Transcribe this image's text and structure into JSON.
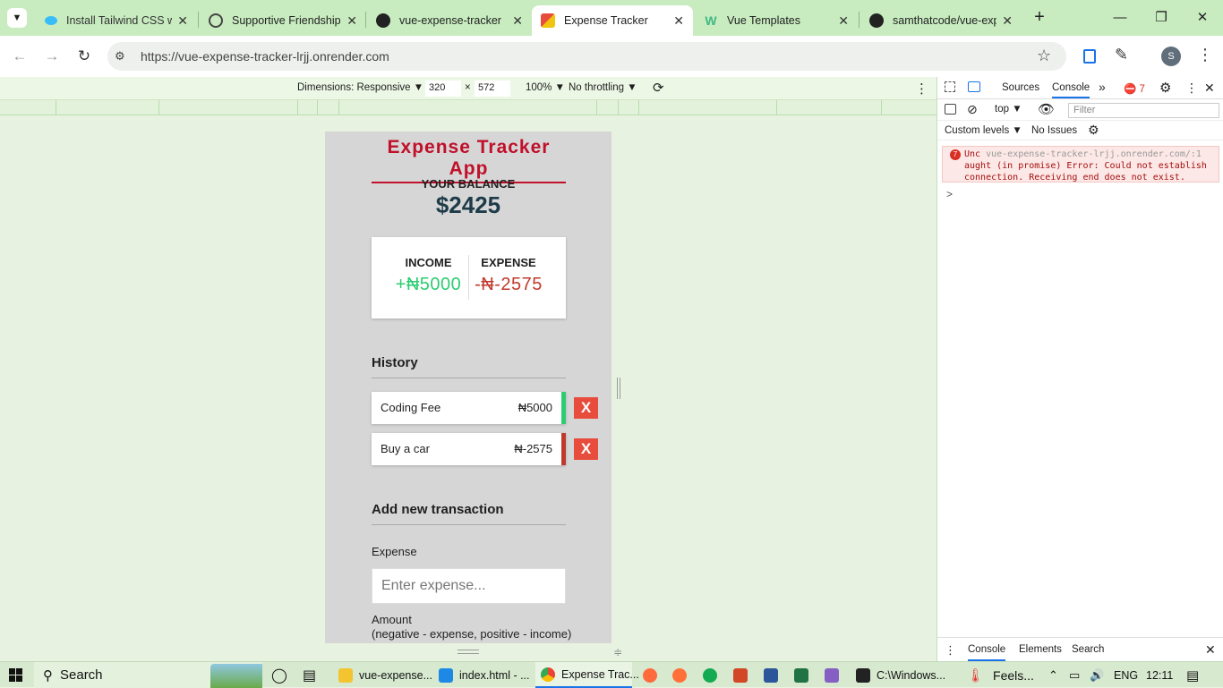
{
  "browser": {
    "tabs": [
      {
        "title": "Install Tailwind CSS wi",
        "favicon": "tailwind-icon",
        "active": false
      },
      {
        "title": "Supportive Friendship",
        "favicon": "chatgpt-icon",
        "active": false
      },
      {
        "title": "vue-expense-tracker",
        "favicon": "render-icon",
        "active": false
      },
      {
        "title": "Expense Tracker",
        "favicon": "app-icon",
        "active": true
      },
      {
        "title": "Vue Templates",
        "favicon": "w-icon",
        "active": false
      },
      {
        "title": "samthatcode/vue-exp",
        "favicon": "github-icon",
        "active": false
      }
    ],
    "url": "https://vue-expense-tracker-lrjj.onrender.com",
    "profile_initial": "S"
  },
  "device_toolbar": {
    "dimensions_label": "Dimensions: Responsive",
    "width": "320",
    "x": "×",
    "height": "572",
    "zoom": "100%",
    "throttling": "No throttling"
  },
  "app": {
    "title": "Expense Tracker App",
    "balance_label": "YOUR BALANCE",
    "balance_value": "$2425",
    "income_label": "INCOME",
    "income_value": "+₦5000",
    "expense_label": "EXPENSE",
    "expense_value": "-₦-2575",
    "history_heading": "History",
    "transactions": [
      {
        "name": "Coding Fee",
        "amount": "₦5000",
        "type": "income",
        "delete_label": "X"
      },
      {
        "name": "Buy a car",
        "amount": "₦-2575",
        "type": "expense",
        "delete_label": "X"
      }
    ],
    "add_heading": "Add new transaction",
    "expense_field_label": "Expense",
    "expense_placeholder": "Enter expense...",
    "amount_label": "Amount",
    "amount_hint": "(negative - expense, positive - income)"
  },
  "devtools": {
    "tabs": [
      "Sources",
      "Console"
    ],
    "active_tab": "Console",
    "error_count": "7",
    "context": "top",
    "filter_placeholder": "Filter",
    "levels": "Custom levels",
    "issues": "No Issues",
    "error_badge": "7",
    "error_source": "vue-expense-tracker-lrjj.onrender.com/:1",
    "error_line1": "Unc",
    "error_text": "aught (in promise) Error: Could not establish connection. Receiving end does not exist.",
    "prompt": ">",
    "drawer_tabs": [
      "Console",
      "Elements",
      "Search"
    ]
  },
  "taskbar": {
    "search_label": "Search",
    "items": [
      {
        "label": "vue-expense...",
        "icon": "folder-icon"
      },
      {
        "label": "index.html - ...",
        "icon": "vscode-icon"
      },
      {
        "label": "Expense Trac...",
        "icon": "chrome-icon"
      },
      {
        "label": "C:\\Windows...",
        "icon": "cmd-icon"
      }
    ],
    "weather": "Feels...",
    "lang": "ENG",
    "time": "12:11"
  },
  "colors": {
    "accent_red": "#c0102a",
    "income_green": "#2ecc71",
    "expense_red": "#c0392b",
    "delete_red": "#e74c3c",
    "balance_dark": "#1d3b49"
  }
}
